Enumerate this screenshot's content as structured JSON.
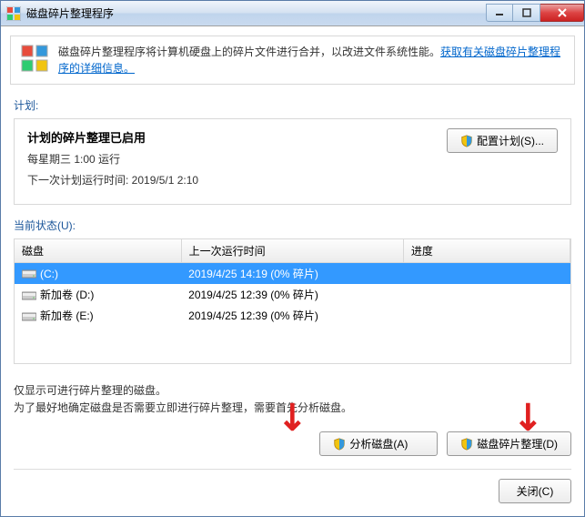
{
  "titlebar": {
    "title": "磁盘碎片整理程序"
  },
  "info": {
    "text": "磁盘碎片整理程序将计算机硬盘上的碎片文件进行合并，以改进文件系统性能。",
    "link": "获取有关磁盘碎片整理程序的详细信息。"
  },
  "schedule": {
    "label": "计划:",
    "title": "计划的碎片整理已启用",
    "line1": "每星期三 1:00 运行",
    "line2": "下一次计划运行时间: 2019/5/1 2:10",
    "config_btn": "配置计划(S)..."
  },
  "status": {
    "label": "当前状态(U):",
    "columns": {
      "disk": "磁盘",
      "lastrun": "上一次运行时间",
      "progress": "进度"
    },
    "rows": [
      {
        "name": "(C:)",
        "lastrun": "2019/4/25 14:19 (0% 碎片)",
        "progress": "",
        "selected": true
      },
      {
        "name": "新加卷 (D:)",
        "lastrun": "2019/4/25 12:39 (0% 碎片)",
        "progress": "",
        "selected": false
      },
      {
        "name": "新加卷 (E:)",
        "lastrun": "2019/4/25 12:39 (0% 碎片)",
        "progress": "",
        "selected": false
      }
    ]
  },
  "hints": {
    "line1": "仅显示可进行碎片整理的磁盘。",
    "line2": "为了最好地确定磁盘是否需要立即进行碎片整理，需要首先分析磁盘。"
  },
  "buttons": {
    "analyze": "分析磁盘(A)",
    "defrag": "磁盘碎片整理(D)",
    "close": "关闭(C)"
  }
}
